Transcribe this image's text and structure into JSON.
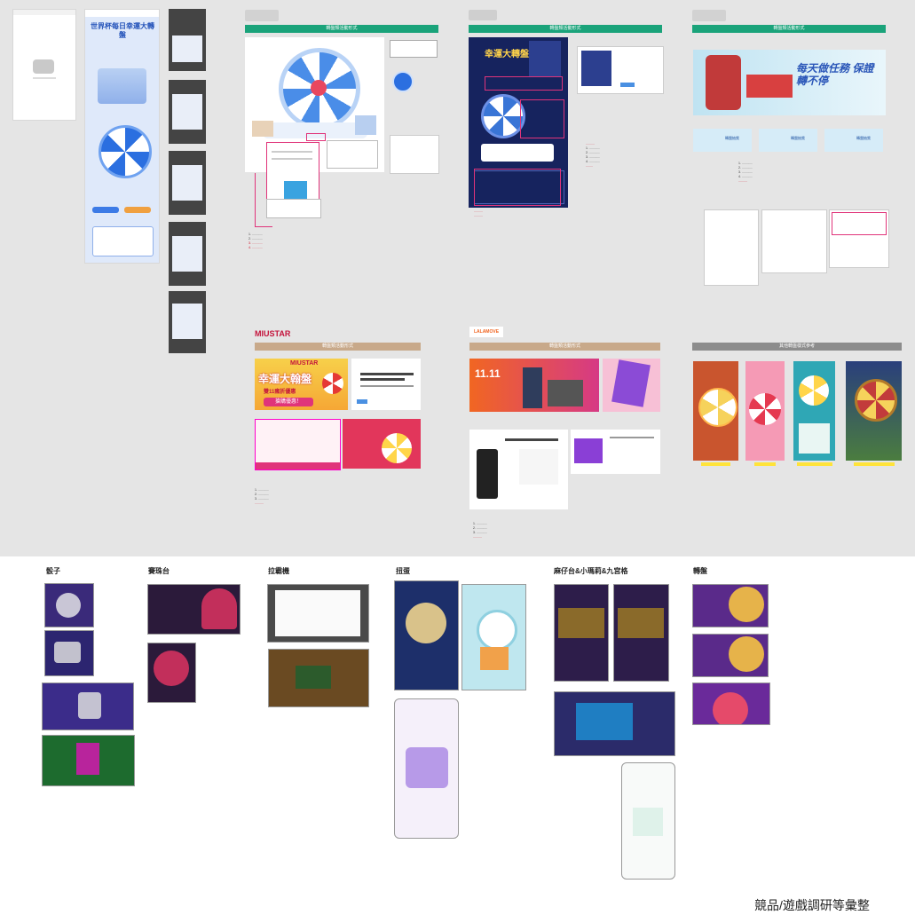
{
  "board": {
    "blue_section": {
      "banner_title": "轉盤類活動形式",
      "note": "可參考轉盤樣式"
    },
    "navy_section": {
      "banner_title": "轉盤類活動形式",
      "poster_title": "幸運大轉盤"
    },
    "green_section": {
      "banner_title": "轉盤類活動形式",
      "banner_slogan": "每天做任務 保證轉不停",
      "tiles": [
        "轉盤抽獎",
        "轉盤抽獎",
        "轉盤抽獎"
      ]
    },
    "miustar": {
      "logo": "MIUSTAR",
      "banner_title": "轉盤類活動形式",
      "poster_brand": "MIUSTAR",
      "poster_title": "幸運大翰盤",
      "poster_sub": "雙11瘋折優惠",
      "poster_btn": "搶購優惠！"
    },
    "lalamove": {
      "logo": "LALAMOVE",
      "banner_title": "轉盤類活動形式",
      "poster_title": "11.11"
    },
    "other": {
      "banner_title": "其他轉盤樣式參考",
      "captions": [
        "",
        "",
        "",
        ""
      ]
    },
    "phone_title": "世界杯每日幸運大轉盤"
  },
  "sections": [
    {
      "title": "骰子"
    },
    {
      "title": "賽珠台"
    },
    {
      "title": "拉霸機"
    },
    {
      "title": "扭蛋"
    },
    {
      "title": "麻仔台&小瑪莉&九宮格"
    },
    {
      "title": "轉盤"
    }
  ],
  "footer": {
    "caption": "競品/遊戲調研等彙整"
  },
  "colors": {
    "green": "#1aa37a",
    "tan": "#c8a98a",
    "gray": "#8c8c8c",
    "pink": "#e0347a",
    "navy": "#16235e"
  }
}
